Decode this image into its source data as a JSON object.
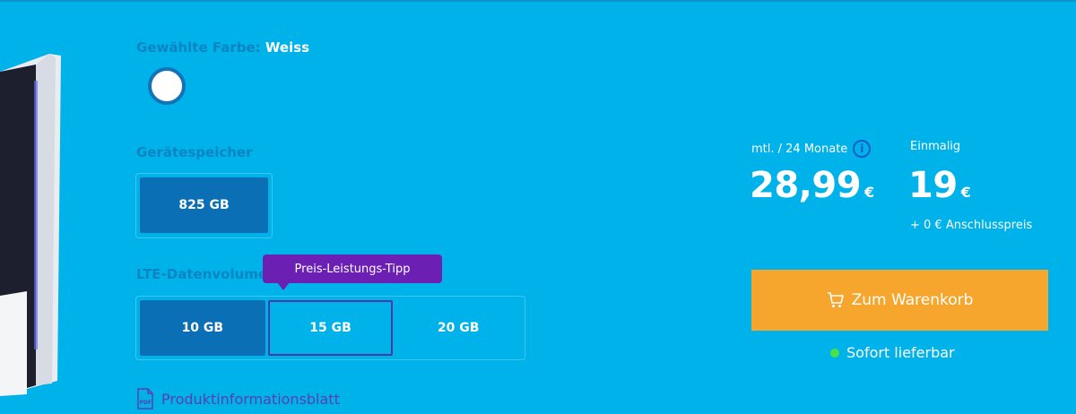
{
  "colors": {
    "background": "#00b2ea",
    "selected": "#0b6fb5",
    "tooltip": "#6b1fb3",
    "cart": "#f6a62c",
    "available": "#4ae14a"
  },
  "color_selection": {
    "label": "Gewählte Farbe:",
    "value": "Weiss"
  },
  "storage": {
    "title": "Gerätespeicher",
    "options": [
      "825 GB"
    ],
    "selected": "825 GB"
  },
  "lte": {
    "title": "LTE-Datenvolumen",
    "options": [
      "10 GB",
      "15 GB",
      "20 GB"
    ],
    "selected": "10 GB",
    "tooltip": "Preis-Leistungs-Tipp"
  },
  "product_info": {
    "label": "Produktinformationsblatt",
    "icon": "pdf-icon"
  },
  "pricing": {
    "monthly_label": "mtl. / 24 Monate",
    "monthly_price": "28,99",
    "once_label": "Einmalig",
    "once_price": "19",
    "currency": "€",
    "connection_fee": "+ 0 € Anschlusspreis"
  },
  "cart": {
    "label": "Zum Warenkorb",
    "icon": "cart-icon"
  },
  "availability": {
    "label": "Sofort lieferbar"
  }
}
